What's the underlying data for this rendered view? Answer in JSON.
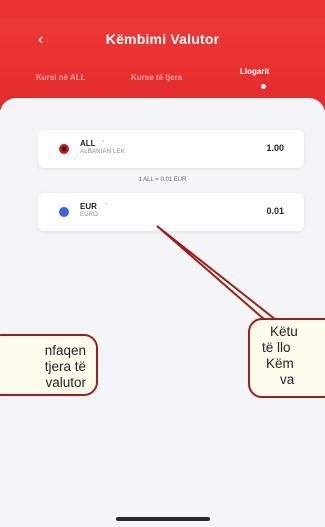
{
  "header": {
    "title": "Këmbimi Valutor",
    "tabs": [
      {
        "label": "Kursi në ALL",
        "active": false
      },
      {
        "label": "Kurse të tjera",
        "active": false
      },
      {
        "label": "Llogarit",
        "active": true
      }
    ]
  },
  "converter": {
    "from": {
      "code": "ALL",
      "name": "ALBANIAN LEK",
      "value": "1.00"
    },
    "rate_text": "1 ALL = 0.01 EUR",
    "to": {
      "code": "EUR",
      "name": "EURO",
      "value": "0.01"
    },
    "chevron": "-"
  },
  "callouts": {
    "left": {
      "lines": [
        "nfaqen",
        "tjera të",
        "valutor"
      ]
    },
    "right": {
      "lines": [
        "Këtu",
        "të llo",
        "Këm",
        "va"
      ]
    }
  },
  "colors": {
    "header_red": "#e42a2a",
    "callout_border": "#a31c1c",
    "callout_fill": "#fffcee"
  },
  "icons": {
    "back": "chevron-left-icon",
    "flag_all": "albania-flag-icon",
    "flag_eur": "euro-flag-icon"
  }
}
